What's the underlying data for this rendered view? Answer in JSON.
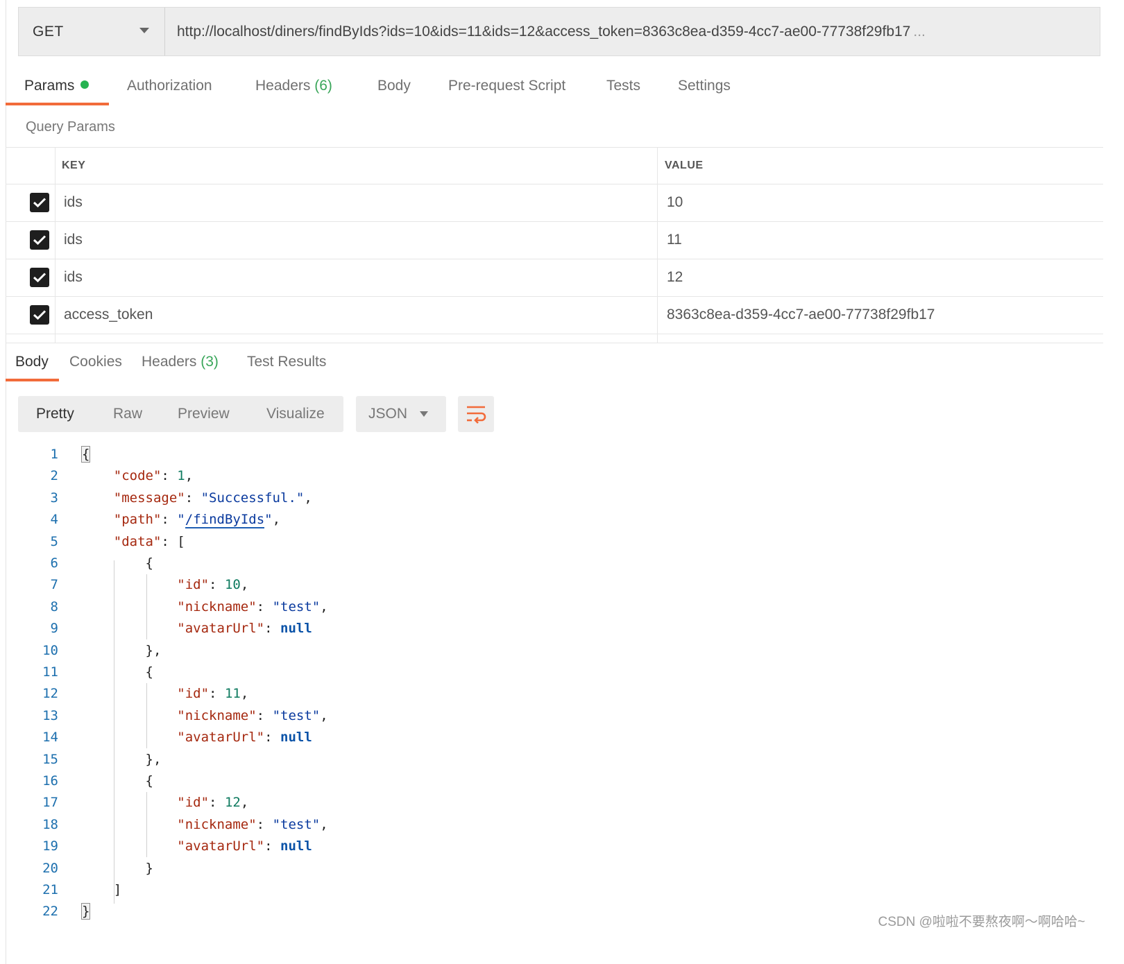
{
  "request": {
    "method": "GET",
    "url": "http://localhost/diners/findByIds?ids=10&ids=11&ids=12&access_token=8363c8ea-d359-4cc7-ae00-77738f29fb17",
    "url_overflow": "..."
  },
  "request_tabs": {
    "params": "Params",
    "authorization": "Authorization",
    "headers": "Headers",
    "headers_count": "(6)",
    "body": "Body",
    "prerequest": "Pre-request Script",
    "tests": "Tests",
    "settings": "Settings"
  },
  "query_params": {
    "title": "Query Params",
    "key_header": "KEY",
    "value_header": "VALUE",
    "rows": [
      {
        "checked": true,
        "key": "ids",
        "value": "10"
      },
      {
        "checked": true,
        "key": "ids",
        "value": "11"
      },
      {
        "checked": true,
        "key": "ids",
        "value": "12"
      },
      {
        "checked": true,
        "key": "access_token",
        "value": "8363c8ea-d359-4cc7-ae00-77738f29fb17"
      }
    ]
  },
  "response_tabs": {
    "body": "Body",
    "cookies": "Cookies",
    "headers": "Headers",
    "headers_count": "(3)",
    "test_results": "Test Results"
  },
  "view_modes": {
    "pretty": "Pretty",
    "raw": "Raw",
    "preview": "Preview",
    "visualize": "Visualize",
    "format": "JSON"
  },
  "response_body": {
    "line_numbers": [
      "1",
      "2",
      "3",
      "4",
      "5",
      "6",
      "7",
      "8",
      "9",
      "10",
      "11",
      "12",
      "13",
      "14",
      "15",
      "16",
      "17",
      "18",
      "19",
      "20",
      "21",
      "22"
    ],
    "code_key": "\"code\"",
    "code_value": "1",
    "message_key": "\"message\"",
    "message_value": "\"Successful.\"",
    "path_key": "\"path\"",
    "path_value": "/findByIds",
    "data_key": "\"data\"",
    "id_key": "\"id\"",
    "nickname_key": "\"nickname\"",
    "avatar_key": "\"avatarUrl\"",
    "items": [
      {
        "id": "10",
        "nickname": "\"test\"",
        "avatarUrl": "null"
      },
      {
        "id": "11",
        "nickname": "\"test\"",
        "avatarUrl": "null"
      },
      {
        "id": "12",
        "nickname": "\"test\"",
        "avatarUrl": "null"
      }
    ]
  },
  "watermark": "CSDN @啦啦不要熬夜啊～啊哈哈~",
  "colors": {
    "accent": "#f26b3a",
    "status_dot": "#26b351",
    "count": "#3aa65a",
    "json_key": "#a5280f",
    "json_string": "#0a3a9e",
    "json_number": "#0e7a5f",
    "json_null": "#0b53a8",
    "line_number": "#1c6fae"
  }
}
